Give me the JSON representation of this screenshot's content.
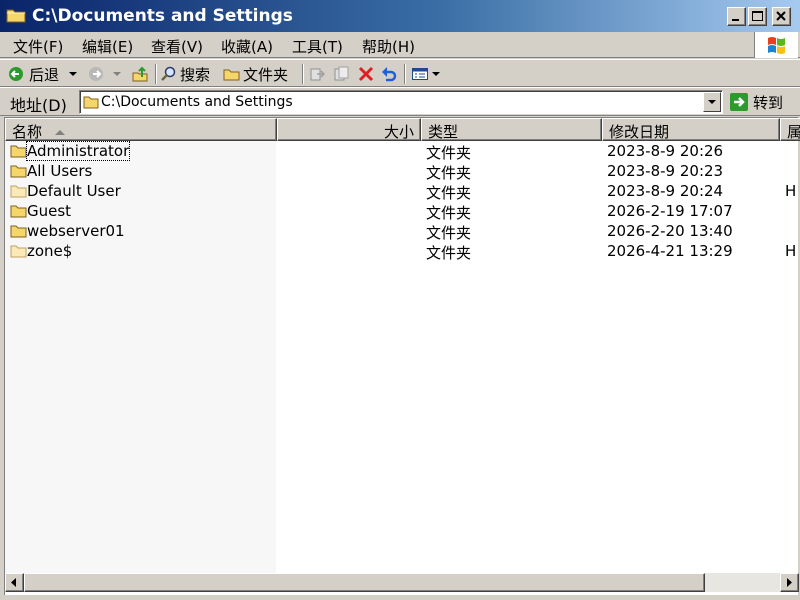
{
  "window": {
    "title": "C:\\Documents and Settings"
  },
  "menu": [
    {
      "label": "文件(F)",
      "shortcut": "F"
    },
    {
      "label": "编辑(E)",
      "shortcut": "E"
    },
    {
      "label": "查看(V)",
      "shortcut": "V"
    },
    {
      "label": "收藏(A)",
      "shortcut": "A"
    },
    {
      "label": "工具(T)",
      "shortcut": "T"
    },
    {
      "label": "帮助(H)",
      "shortcut": "H"
    }
  ],
  "toolbar": {
    "back_label": "后退",
    "search_label": "搜索",
    "folders_label": "文件夹"
  },
  "address": {
    "label": "地址(D)",
    "value": "C:\\Documents and Settings",
    "goto_label": "转到"
  },
  "columns": {
    "name": "名称",
    "size": "大小",
    "type": "类型",
    "modified": "修改日期",
    "attr": "属"
  },
  "files": [
    {
      "name": "Administrator",
      "type": "文件夹",
      "modified": "2023-8-9 20:26",
      "attr": ""
    },
    {
      "name": "All Users",
      "type": "文件夹",
      "modified": "2023-8-9 20:23",
      "attr": ""
    },
    {
      "name": "Default User",
      "type": "文件夹",
      "modified": "2023-8-9 20:24",
      "attr": "H"
    },
    {
      "name": "Guest",
      "type": "文件夹",
      "modified": "2026-2-19 17:07",
      "attr": ""
    },
    {
      "name": "webserver01",
      "type": "文件夹",
      "modified": "2026-2-20 13:40",
      "attr": ""
    },
    {
      "name": "zone$",
      "type": "文件夹",
      "modified": "2026-4-21 13:29",
      "attr": "H"
    }
  ],
  "colors": {
    "titlebar_start": "#0a246a",
    "titlebar_end": "#a6caf0",
    "face": "#d4d0c8",
    "folder": "#f5d66a"
  }
}
